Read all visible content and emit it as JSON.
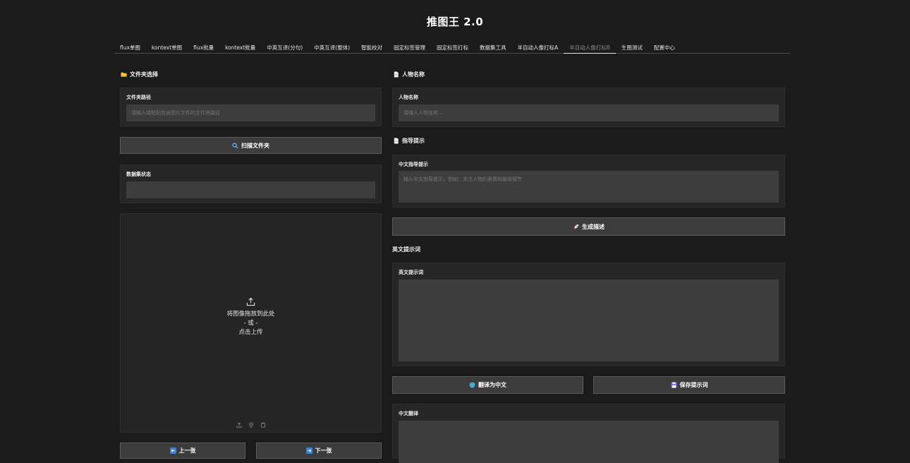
{
  "app": {
    "title": "推图王 2.0"
  },
  "tabs": [
    {
      "label": "flux单图"
    },
    {
      "label": "kontext单图"
    },
    {
      "label": "flux批量"
    },
    {
      "label": "kontext批量"
    },
    {
      "label": "中英互译(分句)"
    },
    {
      "label": "中英互译(整体)"
    },
    {
      "label": "智能校对"
    },
    {
      "label": "固定标签管理"
    },
    {
      "label": "固定标签打标"
    },
    {
      "label": "数据集工具"
    },
    {
      "label": "半自动人像打标A"
    },
    {
      "label": "半自动人像打标B"
    },
    {
      "label": "生图测试"
    },
    {
      "label": "配置中心"
    }
  ],
  "active_tab": "半自动人像打标B",
  "left": {
    "folder_section_title": "文件夹选择",
    "folder_path_label": "文件夹路径",
    "folder_path_placeholder": "请输入或粘贴包含图片文件的文件夹路径",
    "folder_path_value": "",
    "scan_button": "扫描文件夹",
    "dataset_status_label": "数据集状态",
    "dataset_status_value": "",
    "upload_line1": "将图像拖放到此处",
    "upload_line2": "- 或 -",
    "upload_line3": "点击上传",
    "prev_button": "上一张",
    "next_button": "下一张"
  },
  "right": {
    "person_section_title": "人物名称",
    "person_label": "人物名称",
    "person_placeholder": "请输入人物名称...",
    "person_value": "",
    "guide_section_title": "指导提示",
    "guide_label": "中文指导提示",
    "guide_placeholder": "输入中文指导提示，例如：关注人物的表情和服装细节",
    "guide_value": "",
    "generate_button": "生成描述",
    "english_section_title": "英文提示词",
    "english_label": "英文提示词",
    "english_value": "",
    "translate_button": "翻译为中文",
    "save_button": "保存提示词",
    "chinese_label": "中文翻译",
    "chinese_value": ""
  },
  "icons": {
    "folder": "folder-icon",
    "search": "search-icon",
    "document": "document-icon",
    "rocket": "rocket-icon",
    "globe": "globe-icon",
    "save": "save-icon",
    "upload": "upload-icon",
    "left_arrow": "left-arrow-icon",
    "right_arrow": "right-arrow-icon"
  },
  "colors": {
    "background": "#1b1b1b",
    "panel": "#262626",
    "input": "#3d3d3d",
    "button": "#3c3c3c",
    "text": "#e6e6e6"
  }
}
